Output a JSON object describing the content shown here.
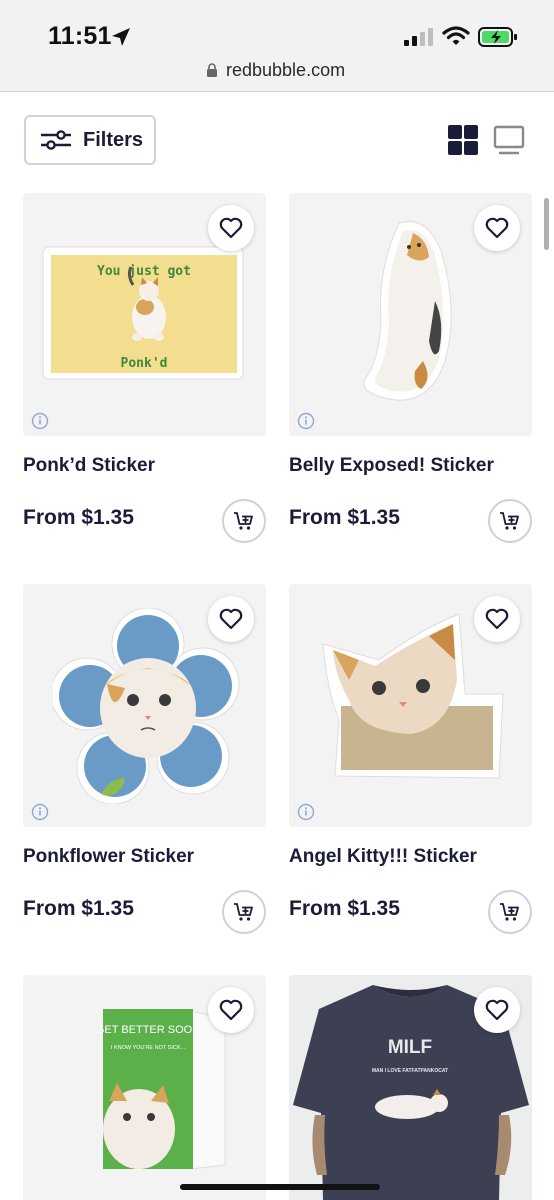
{
  "status_bar": {
    "time": "11:51",
    "icons": [
      "location-arrow-icon",
      "cellular-signal-icon",
      "wifi-icon",
      "battery-charging-icon"
    ],
    "battery_color": "#4cd964"
  },
  "url_bar": {
    "url": "redbubble.com"
  },
  "toolbar": {
    "filters_label": "Filters",
    "view_mode": "grid",
    "accent_color": "#1b1b3a"
  },
  "products": [
    {
      "title": "Ponk’d Sticker",
      "price": "From $1.35",
      "art_text_top": "You just got",
      "art_text_bottom": "Ponk'd"
    },
    {
      "title": "Belly Exposed! Sticker",
      "price": "From $1.35"
    },
    {
      "title": "Ponkflower Sticker",
      "price": "From $1.35"
    },
    {
      "title": "Angel Kitty!!! Sticker",
      "price": "From $1.35"
    },
    {
      "title": "",
      "price": "",
      "art_text_top": "GET BETTER SOON",
      "art_text_sub": "I KNOW YOU'RE NOT SICK..."
    },
    {
      "title": "",
      "price": "",
      "art_text_top": "MILF",
      "art_text_sub": "MAN I LOVE FATFATPANKOCAT"
    }
  ]
}
